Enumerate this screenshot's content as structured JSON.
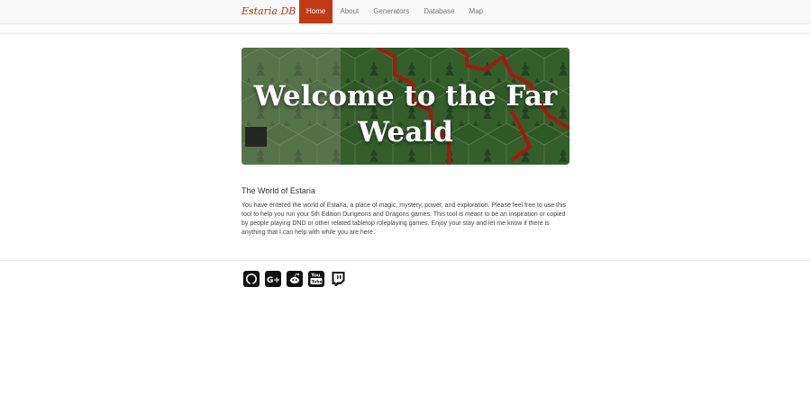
{
  "brand": "Estaria DB",
  "nav": {
    "items": [
      "Home",
      "About",
      "Generators",
      "Database",
      "Map"
    ],
    "active": "Home"
  },
  "hero": {
    "title_line1": "Welcome to the Far",
    "title_line2": "Weald"
  },
  "main": {
    "section_title": "The World of Estaria",
    "intro": "You have entered the world of Estaria, a place of magic, mystery, power, and exploration. Please feel free to use this tool to help you run your 5th Edition Dungeons and Dragons games. This tool is meant to be an inspiration or copied by people playing DND or other related tabletop roleplaying games. Enjoy your stay and let me know if there is anything that I can help with while you are here."
  },
  "social": [
    "github-icon",
    "google-plus-icon",
    "reddit-icon",
    "youtube-icon",
    "twitch-icon"
  ],
  "colors": {
    "accent": "#c23a14",
    "brand": "#b5391f",
    "map_green": "#2f5a27",
    "map_border": "#b41d1d"
  }
}
